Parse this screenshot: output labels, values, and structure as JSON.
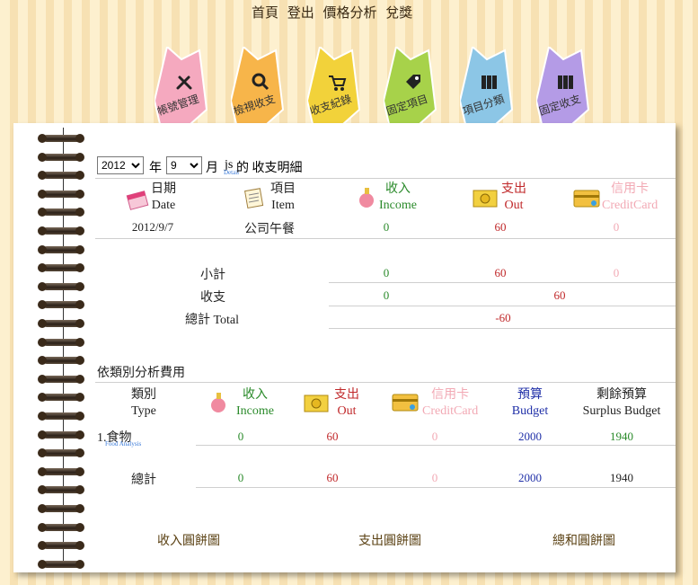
{
  "topnav": {
    "home": "首頁",
    "logout": "登出",
    "price_analysis": "價格分析",
    "redeem": "兌獎"
  },
  "tabs": [
    {
      "label": "帳號管理",
      "color": "#f5a9bf",
      "icon": "tools-icon"
    },
    {
      "label": "檢視收支",
      "color": "#f7b54a",
      "icon": "magnifier-icon"
    },
    {
      "label": "收支紀錄",
      "color": "#f2d23a",
      "icon": "cart-icon"
    },
    {
      "label": "固定項目",
      "color": "#a7d24a",
      "icon": "tag-icon"
    },
    {
      "label": "項目分類",
      "color": "#8cc6e6",
      "icon": "binders-icon"
    },
    {
      "label": "固定收支",
      "color": "#b49be6",
      "icon": "binders-icon"
    }
  ],
  "filter": {
    "year": "2012",
    "year_unit": "年",
    "month": "9",
    "month_unit": "月",
    "user": "js",
    "user_sub": "Detail",
    "suffix": "的 收支明細"
  },
  "detail": {
    "headers": {
      "date": {
        "zh": "日期",
        "en": "Date"
      },
      "item": {
        "zh": "項目",
        "en": "Item"
      },
      "income": {
        "zh": "收入",
        "en": "Income"
      },
      "out": {
        "zh": "支出",
        "en": "Out"
      },
      "credit": {
        "zh": "信用卡",
        "en": "CreditCard"
      }
    },
    "rows": [
      {
        "date": "2012/9/7",
        "item": "公司午餐",
        "income": "0",
        "out": "60",
        "credit": "0"
      }
    ],
    "subtotal": {
      "label": "小計",
      "income": "0",
      "out": "60",
      "credit": "0"
    },
    "balance": {
      "label": "收支",
      "income": "0",
      "out": "60"
    },
    "total": {
      "label": "總計 Total",
      "value": "-60"
    }
  },
  "category": {
    "title": "依類別分析費用",
    "headers": {
      "type": {
        "zh": "類別",
        "en": "Type"
      },
      "income": {
        "zh": "收入",
        "en": "Income"
      },
      "out": {
        "zh": "支出",
        "en": "Out"
      },
      "credit": {
        "zh": "信用卡",
        "en": "CreditCard"
      },
      "budget": {
        "zh": "預算",
        "en": "Budget"
      },
      "surplus": {
        "zh": "剩餘預算",
        "en": "Surplus Budget"
      }
    },
    "rows": [
      {
        "name": "1.食物",
        "sub": "Food Analysis",
        "income": "0",
        "out": "60",
        "credit": "0",
        "budget": "2000",
        "surplus": "1940"
      }
    ],
    "total": {
      "label": "總計",
      "income": "0",
      "out": "60",
      "credit": "0",
      "budget": "2000",
      "surplus": "1940"
    }
  },
  "pies": {
    "income": "收入圓餅圖",
    "out": "支出圓餅圖",
    "sum": "總和圓餅圖"
  }
}
